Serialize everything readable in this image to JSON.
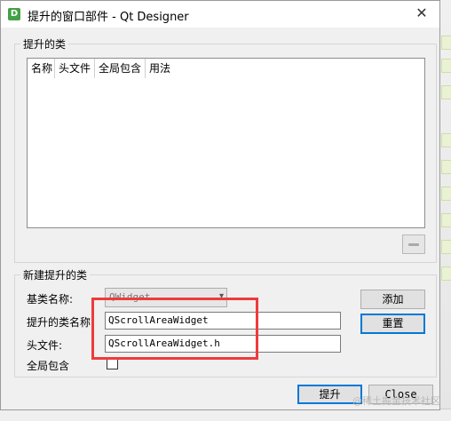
{
  "window": {
    "app_icon": "D",
    "title": "提升的窗口部件 - Qt Designer",
    "close_glyph": "✕"
  },
  "promoted_group": {
    "title": "提升的类",
    "columns": [
      "名称",
      "头文件",
      "全局包含",
      "用法"
    ],
    "rows": []
  },
  "new_group": {
    "title": "新建提升的类",
    "base_class_label": "基类名称:",
    "base_class_value": "QWidget",
    "class_name_label": "提升的类名称",
    "class_name_value": "QScrollAreaWidget",
    "header_label": "头文件:",
    "header_value": "QScrollAreaWidget.h",
    "global_include_label": "全局包含",
    "global_include_checked": false,
    "add_button": "添加",
    "reset_button": "重置"
  },
  "footer": {
    "promote_button": "提升",
    "close_button": "Close"
  },
  "watermark": "@稀土掘金技术社区",
  "colors": {
    "highlight": "#ee3b3b",
    "default_button_border": "#0078d7"
  }
}
